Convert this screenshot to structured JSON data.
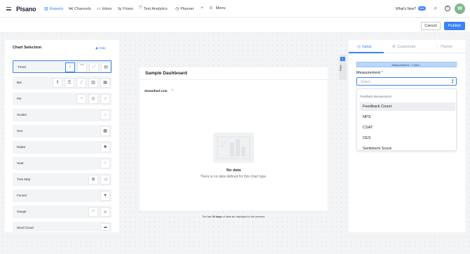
{
  "nav": {
    "logo": "Pisano",
    "items": [
      {
        "label": "Reports",
        "icon": "reports-icon"
      },
      {
        "label": "Channels",
        "icon": "channels-icon"
      },
      {
        "label": "Inbox",
        "icon": "inbox-icon"
      },
      {
        "label": "Flows",
        "icon": "flows-icon"
      },
      {
        "label": "Text Analytics",
        "icon": "text-analytics-icon"
      },
      {
        "label": "Planner",
        "icon": "planner-icon"
      },
      {
        "label": "Menu",
        "icon": "menu-icon"
      }
    ],
    "whats_new": "What's New?",
    "new_badge": "New",
    "avatar_initial": "W"
  },
  "actions": {
    "cancel": "Cancel",
    "publish": "Publish"
  },
  "chart_selection": {
    "title": "Chart Selection",
    "hide": "Hide",
    "types": [
      {
        "label": "Trend",
        "selected": true
      },
      {
        "label": "Bar"
      },
      {
        "label": "Pie"
      },
      {
        "label": "Scatter"
      },
      {
        "label": "Geo"
      },
      {
        "label": "Radar"
      },
      {
        "label": "Heat"
      },
      {
        "label": "Tree Map"
      },
      {
        "label": "Funnel"
      },
      {
        "label": "Gauge"
      },
      {
        "label": "Word Cloud"
      }
    ]
  },
  "dashboard": {
    "title": "Sample Dashboard",
    "chart_name": "Smoothed Line",
    "no_data_title": "No data",
    "no_data_desc": "There is no data defined for this chart type.",
    "footnote_pre": "The last ",
    "footnote_bold": "30 days",
    "footnote_post": " of data are displayed in the preview."
  },
  "filter": {
    "count": "1",
    "label": "Filter"
  },
  "settings": {
    "tabs": [
      {
        "label": "Value",
        "active": true
      },
      {
        "label": "Customize"
      },
      {
        "label": "Theme"
      }
    ],
    "measurement_bar": "Measurement - Y Axis",
    "measurement_label": "Measurement",
    "required_mark": "*",
    "placeholder": "Select",
    "dropdown_header": "Feedback Measurement",
    "options": [
      "Feedback Count",
      "NPS",
      "CSAT",
      "CES",
      "Sentiment Score"
    ]
  },
  "colors": {
    "accent": "#3b82f6",
    "avatar": "#7fb88a"
  }
}
